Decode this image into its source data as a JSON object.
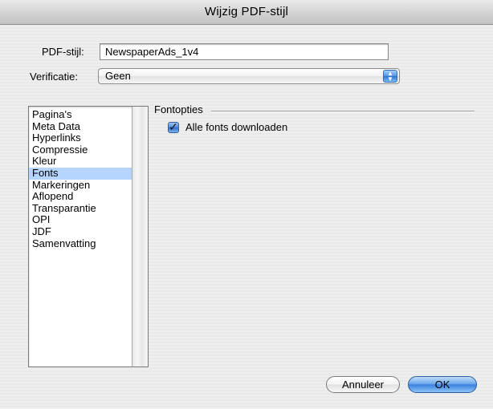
{
  "window": {
    "title": "Wijzig PDF-stijl"
  },
  "form": {
    "style_label": "PDF-stijl:",
    "style_value": "NewspaperAds_1v4",
    "verification_label": "Verificatie:",
    "verification_value": "Geen"
  },
  "sidebar": {
    "items": [
      {
        "label": "Pagina's"
      },
      {
        "label": "Meta Data"
      },
      {
        "label": "Hyperlinks"
      },
      {
        "label": "Compressie"
      },
      {
        "label": "Kleur"
      },
      {
        "label": "Fonts",
        "selected": true
      },
      {
        "label": "Markeringen"
      },
      {
        "label": "Aflopend"
      },
      {
        "label": "Transparantie"
      },
      {
        "label": "OPI"
      },
      {
        "label": "JDF"
      },
      {
        "label": "Samenvatting"
      }
    ]
  },
  "panel": {
    "section_title": "Fontopties",
    "download_all_fonts": {
      "label": "Alle fonts downloaden",
      "checked": true
    }
  },
  "buttons": {
    "cancel": "Annuleer",
    "ok": "OK"
  },
  "colors": {
    "selection": "#b5d5ff",
    "accent_blue": "#3b82de",
    "window_bg": "#ececec"
  }
}
